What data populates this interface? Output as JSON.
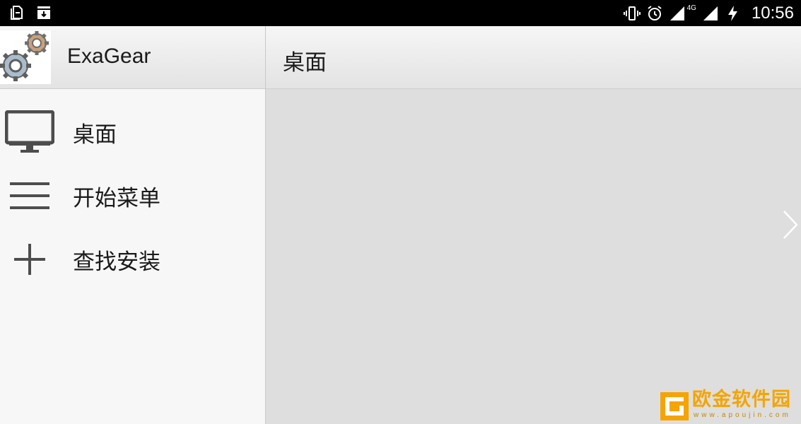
{
  "status_bar": {
    "left_icons": [
      "document-icon",
      "download-tray-icon"
    ],
    "right_icons": [
      "vibrate-icon",
      "alarm-icon",
      "signal-icon",
      "signal-4g-icon",
      "charging-icon"
    ],
    "network_label": "4G",
    "time": "10:56"
  },
  "drawer": {
    "app_name": "ExaGear",
    "items": [
      {
        "label": "桌面",
        "icon": "monitor-icon"
      },
      {
        "label": "开始菜单",
        "icon": "menu-lines-icon"
      },
      {
        "label": "查找安装",
        "icon": "plus-icon"
      }
    ]
  },
  "content": {
    "title": "桌面",
    "next_icon": "chevron-right-icon"
  },
  "watermark": {
    "name": "欧金软件园",
    "url": "www.apoujin.com",
    "color": "#f5a400"
  },
  "colors": {
    "status_bar_bg": "#000000",
    "drawer_bg": "#f7f7f7",
    "content_bg": "#dedede",
    "text": "#1a1a1a",
    "icon_gray": "#4d4d4d"
  }
}
